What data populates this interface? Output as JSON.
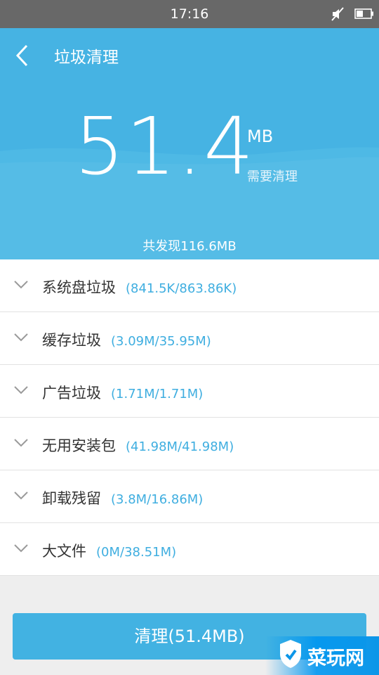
{
  "status_bar": {
    "time": "17:16"
  },
  "header": {
    "title": "垃圾清理"
  },
  "summary": {
    "amount": "51.4",
    "unit": "MB",
    "caption": "需要清理",
    "total_found": "共发现116.6MB"
  },
  "categories": [
    {
      "label": "系统盘垃圾",
      "size": "(841.5K/863.86K)"
    },
    {
      "label": "缓存垃圾",
      "size": "(3.09M/35.95M)"
    },
    {
      "label": "广告垃圾",
      "size": "(1.71M/1.71M)"
    },
    {
      "label": "无用安装包",
      "size": "(41.98M/41.98M)"
    },
    {
      "label": "卸载残留",
      "size": "(3.8M/16.86M)"
    },
    {
      "label": "大文件",
      "size": "(0M/38.51M)"
    }
  ],
  "action": {
    "clean_label": "清理(51.4MB)"
  },
  "watermark": {
    "text": "菜玩网"
  },
  "colors": {
    "accent": "#46b3e3",
    "size_text": "#3faee0",
    "status_bar": "#686868"
  },
  "icons": {
    "back": "chevron-left-icon",
    "expand": "chevron-down-icon",
    "mute": "mute-icon",
    "battery": "battery-icon"
  }
}
